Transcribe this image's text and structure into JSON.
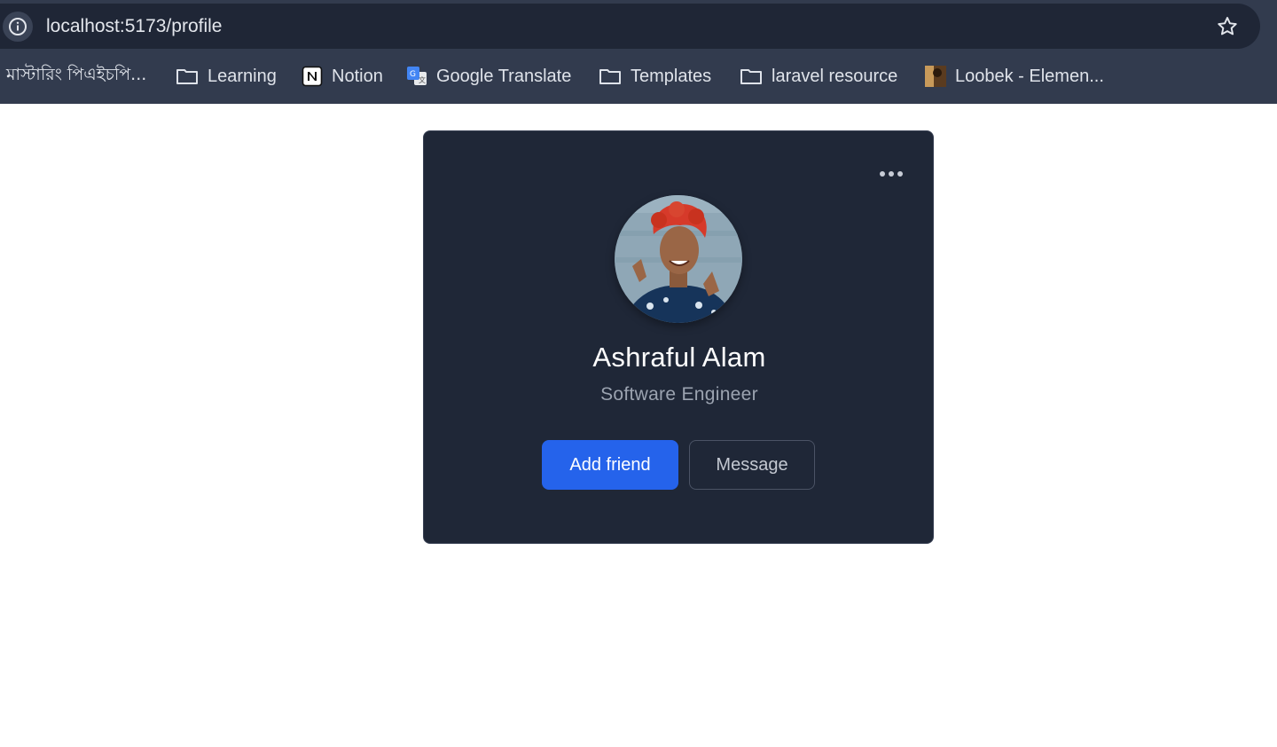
{
  "browser": {
    "url": "localhost:5173/profile",
    "bookmarks": [
      {
        "label": "মাস্টারিং পিএইচপি...",
        "icon": "none"
      },
      {
        "label": "Learning",
        "icon": "folder-icon"
      },
      {
        "label": "Notion",
        "icon": "notion-icon"
      },
      {
        "label": "Google Translate",
        "icon": "google-translate-icon"
      },
      {
        "label": "Templates",
        "icon": "folder-icon"
      },
      {
        "label": "laravel resource",
        "icon": "folder-icon"
      },
      {
        "label": "Loobek - Elemen...",
        "icon": "site-favicon"
      }
    ]
  },
  "profile": {
    "name": "Ashraful Alam",
    "role": "Software Engineer",
    "add_friend_label": "Add friend",
    "message_label": "Message"
  },
  "colors": {
    "card_bg": "#1f2737",
    "primary": "#2563eb",
    "browser_bg": "#323b4e"
  }
}
